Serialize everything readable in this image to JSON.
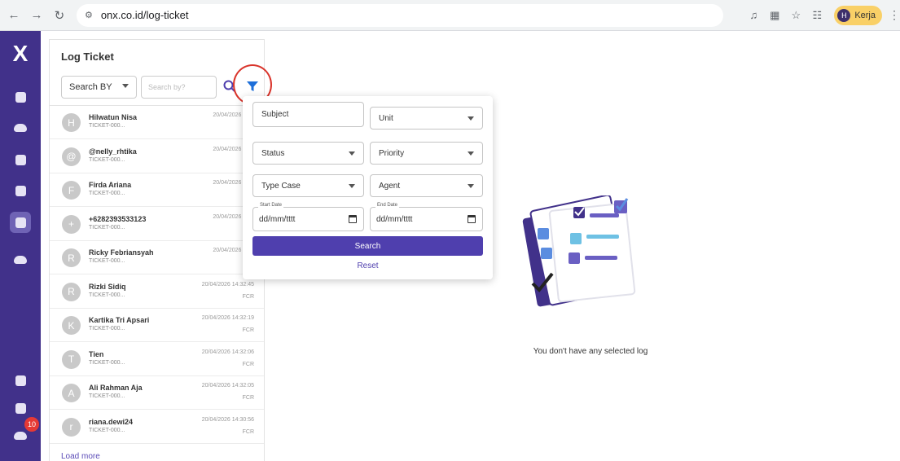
{
  "browser": {
    "url": "onx.co.id/log-ticket",
    "profile_initial": "H",
    "profile_label": "Kerja"
  },
  "rail": {
    "logo": "X",
    "notification_count": "10"
  },
  "panel": {
    "title": "Log Ticket",
    "search_by_label": "Search BY",
    "search_placeholder": "Search by?",
    "load_more": "Load more"
  },
  "tickets": [
    {
      "initial": "H",
      "name": "Hilwatun Nisa",
      "id": "TICKET-000...",
      "time": "20/04/2026 14:3",
      "tag": ""
    },
    {
      "initial": "@",
      "name": "@nelly_rhtika",
      "id": "TICKET-000...",
      "time": "20/04/2026 14:3",
      "tag": ""
    },
    {
      "initial": "F",
      "name": "Firda Ariana",
      "id": "TICKET-000...",
      "time": "20/04/2026 14:3",
      "tag": ""
    },
    {
      "initial": "+",
      "name": "+6282393533123",
      "id": "TICKET-000...",
      "time": "20/04/2026 14:3",
      "tag": ""
    },
    {
      "initial": "R",
      "name": "Ricky Febriansyah",
      "id": "TICKET-000...",
      "time": "20/04/2026 14:3",
      "tag": ""
    },
    {
      "initial": "R",
      "name": "Rizki Sidiq",
      "id": "TICKET-000...",
      "time": "20/04/2026 14:32:45",
      "tag": "FCR"
    },
    {
      "initial": "K",
      "name": "Kartika Tri Apsari",
      "id": "TICKET-000...",
      "time": "20/04/2026 14:32:19",
      "tag": "FCR"
    },
    {
      "initial": "T",
      "name": "Tien",
      "id": "TICKET-000...",
      "time": "20/04/2026 14:32:06",
      "tag": "FCR"
    },
    {
      "initial": "A",
      "name": "Ali Rahman Aja",
      "id": "TICKET-000...",
      "time": "20/04/2026 14:32:05",
      "tag": "FCR"
    },
    {
      "initial": "r",
      "name": "riana.dewi24",
      "id": "TICKET-000...",
      "time": "20/04/2026 14:30:56",
      "tag": "FCR"
    }
  ],
  "filter": {
    "subject_placeholder": "Subject",
    "unit": "Unit",
    "status": "Status",
    "priority": "Priority",
    "type_case": "Type Case",
    "agent": "Agent",
    "start_date_label": "Start Date",
    "end_date_label": "End Date",
    "date_placeholder": "dd/mm/tttt",
    "search_button": "Search",
    "reset": "Reset"
  },
  "empty_state": {
    "message": "You don't have any selected log"
  },
  "colors": {
    "rail": "#41318a",
    "accent": "#4f3fae",
    "filter_icon": "#1e6fd9",
    "highlight_ring": "#d9342b"
  }
}
